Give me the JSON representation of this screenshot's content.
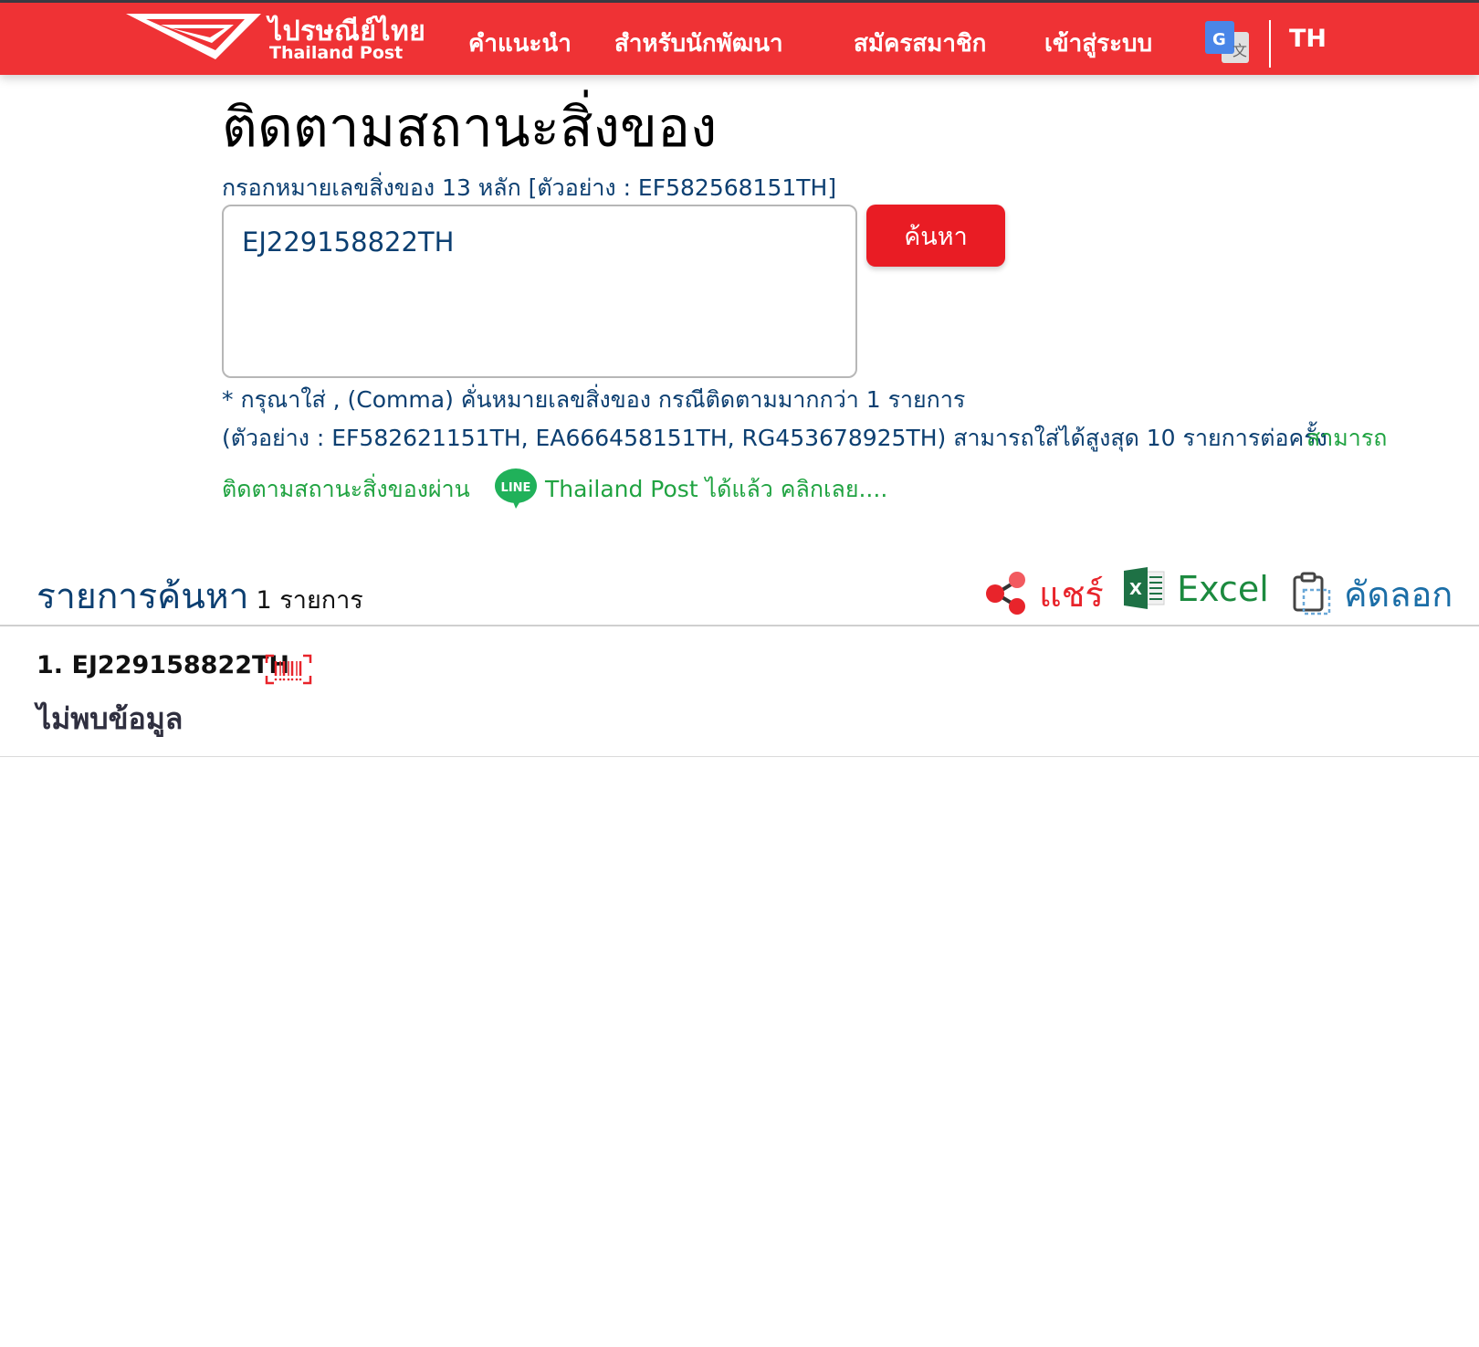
{
  "header": {
    "logo_thai": "ไปรษณีย์ไทย",
    "logo_eng": "Thailand Post",
    "nav": [
      "คำแนะนำ",
      "สำหรับนักพัฒนา",
      "สมัครสมาชิก",
      "เข้าสู่ระบบ"
    ],
    "lang": "TH",
    "brand_color": "#ef3235"
  },
  "main": {
    "title": "ติดตามสถานะสิ่งของ",
    "hint": "กรอกหมายเลขสิ่งของ 13 หลัก [ตัวอย่าง : EF582568151TH]",
    "input_value": "EJ229158822TH",
    "search_label": "ค้นหา",
    "note1": "* กรุณาใส่ , (Comma) คั่นหมายเลขสิ่งของ กรณีติดตามมากกว่า 1 รายการ",
    "note2": "(ตัวอย่าง : EF582621151TH, EA666458151TH, RG453678925TH) สามารถใส่ได้สูงสุด 10 รายการต่อครั้ง",
    "line_promo_a": "สามารถ",
    "line_promo_b": "ติดตามสถานะสิ่งของผ่าน",
    "line_icon_text": "LINE",
    "line_promo_c": "Thailand Post ได้แล้ว คลิกเลย...."
  },
  "results": {
    "title": "รายการค้นหา",
    "count": "1 รายการ",
    "actions": {
      "share": "แชร์",
      "excel": "Excel",
      "copy": "คัดลอก"
    },
    "items": [
      {
        "label": "1. EJ229158822TH",
        "status": "ไม่พบข้อมูล"
      }
    ]
  }
}
